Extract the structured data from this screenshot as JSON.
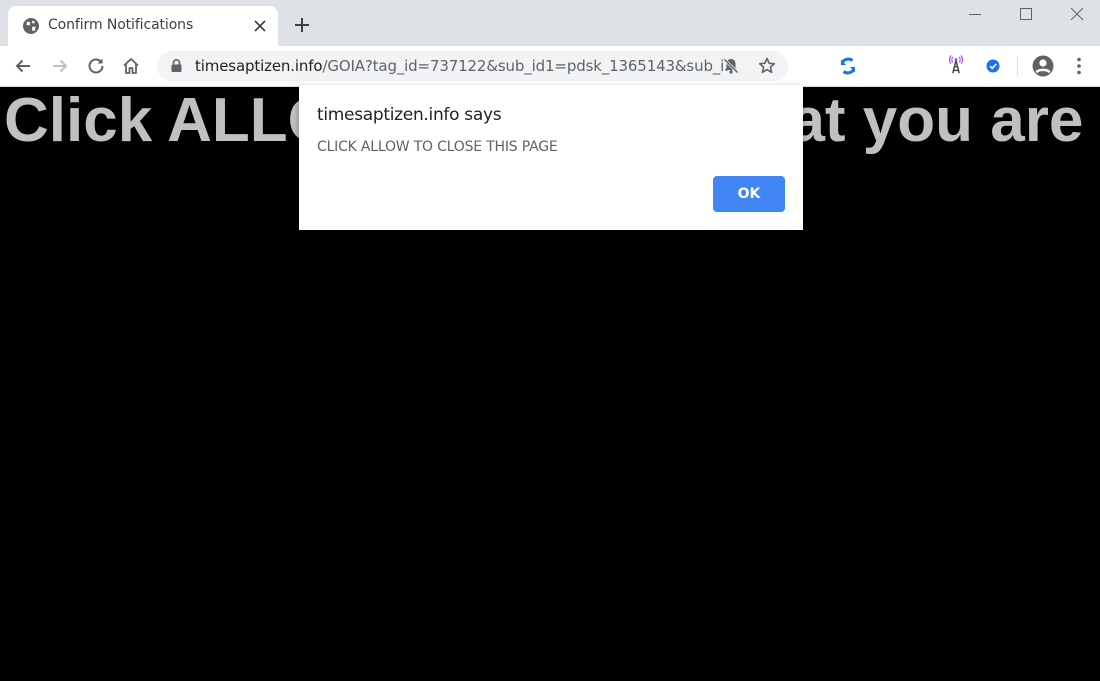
{
  "tab": {
    "title": "Confirm Notifications",
    "favicon": "globe-icon"
  },
  "window_controls": [
    "minimize-icon",
    "maximize-icon",
    "close-icon"
  ],
  "address_bar": {
    "host": "timesaptizen.info",
    "path": "/GOIA?tag_id=737122&sub_id1=pdsk_1365143&sub_i..."
  },
  "extensions": [
    "sync-extension-icon",
    "antenna-extension-icon",
    "blue-check-extension-icon"
  ],
  "page": {
    "headline": "Click ALLOW to confirm that you are"
  },
  "dialog": {
    "title": "timesaptizen.info says",
    "message": "CLICK ALLOW TO CLOSE THIS PAGE",
    "ok_label": "OK"
  },
  "colors": {
    "accent": "#4285f4",
    "page_background": "#000000",
    "headline": "#c0c0c0"
  }
}
